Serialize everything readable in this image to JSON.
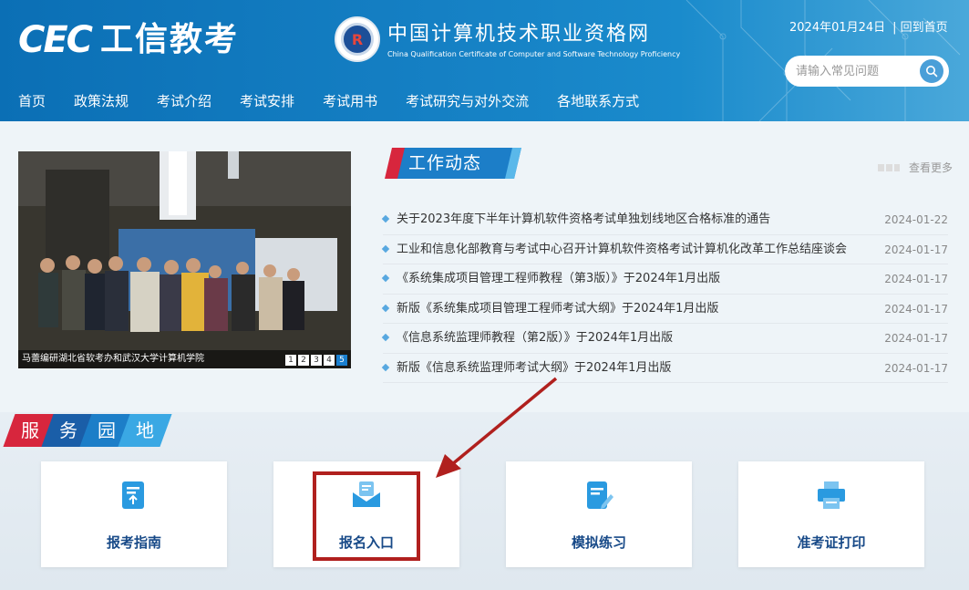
{
  "header": {
    "logo_text": "CEC",
    "logo_cn": "工信教考",
    "seal_mark": "R",
    "site_title": "中国计算机技术职业资格网",
    "site_title_en": "China Qualification Certificate of Computer and Software Technology Proficiency",
    "date": "2024年01月24日",
    "sep": "|",
    "home_link": "回到首页",
    "search_placeholder": "请输入常见问题"
  },
  "nav": [
    "首页",
    "政策法规",
    "考试介绍",
    "考试安排",
    "考试用书",
    "考试研究与对外交流",
    "各地联系方式"
  ],
  "carousel": {
    "caption": "马蕾编研湖北省软考办和武汉大学计算机学院",
    "pages": [
      "1",
      "2",
      "3",
      "4",
      "5"
    ],
    "active_page": 5
  },
  "news": {
    "heading": "工作动态",
    "more": "查看更多",
    "items": [
      {
        "title": "关于2023年度下半年计算机软件资格考试单独划线地区合格标准的通告",
        "date": "2024-01-22"
      },
      {
        "title": "工业和信息化部教育与考试中心召开计算机软件资格考试计算机化改革工作总结座谈会",
        "date": "2024-01-17"
      },
      {
        "title": "《系统集成项目管理工程师教程（第3版）》于2024年1月出版",
        "date": "2024-01-17"
      },
      {
        "title": "新版《系统集成项目管理工程师考试大纲》于2024年1月出版",
        "date": "2024-01-17"
      },
      {
        "title": "《信息系统监理师教程（第2版）》于2024年1月出版",
        "date": "2024-01-17"
      },
      {
        "title": "新版《信息系统监理师考试大纲》于2024年1月出版",
        "date": "2024-01-17"
      }
    ]
  },
  "service": {
    "heading_chars": [
      "服",
      "务",
      "园",
      "地"
    ],
    "cards": [
      "报考指南",
      "报名入口",
      "模拟练习",
      "准考证打印"
    ]
  },
  "colors": {
    "header_blue": "#1580c4",
    "card_label": "#184a88",
    "highlight_red": "#b0201e",
    "service_red": "#d7263d"
  }
}
